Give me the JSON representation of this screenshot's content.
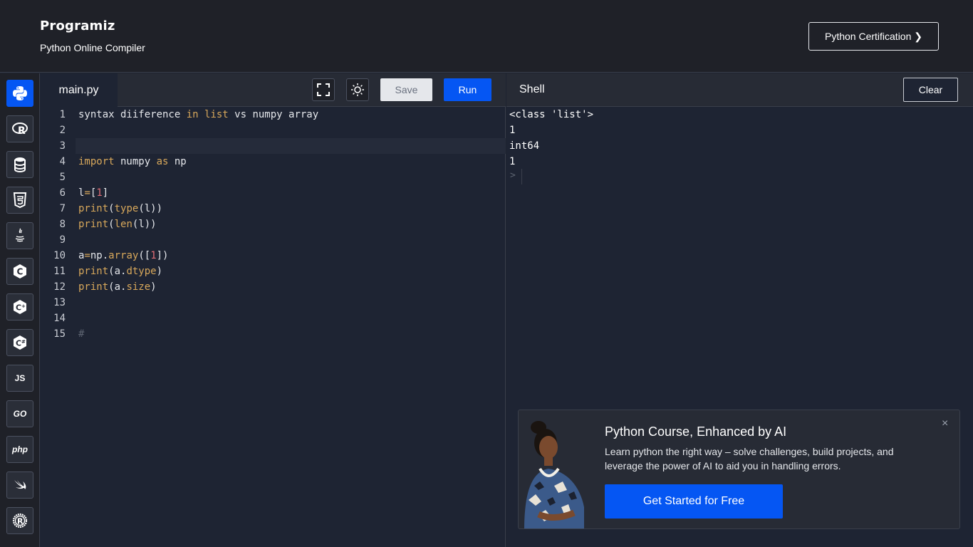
{
  "header": {
    "logo_text": "Programiz",
    "subtitle": "Python Online Compiler",
    "cert_button": "Python Certification ❯"
  },
  "sidebar": {
    "languages": [
      {
        "name": "python",
        "icon": "python-icon",
        "active": true
      },
      {
        "name": "r",
        "icon": "r-icon",
        "active": false
      },
      {
        "name": "sql",
        "icon": "database-icon",
        "active": false
      },
      {
        "name": "html",
        "icon": "html5-icon",
        "active": false
      },
      {
        "name": "java",
        "icon": "java-icon",
        "active": false
      },
      {
        "name": "c",
        "icon": "c-icon",
        "active": false
      },
      {
        "name": "cpp",
        "icon": "cpp-icon",
        "active": false
      },
      {
        "name": "csharp",
        "icon": "csharp-icon",
        "active": false
      },
      {
        "name": "js",
        "icon": "js-icon",
        "label": "JS",
        "active": false
      },
      {
        "name": "go",
        "icon": "go-icon",
        "label": "GO",
        "active": false
      },
      {
        "name": "php",
        "icon": "php-icon",
        "label": "php",
        "active": false
      },
      {
        "name": "swift",
        "icon": "swift-icon",
        "active": false
      },
      {
        "name": "rust",
        "icon": "rust-icon",
        "active": false
      }
    ]
  },
  "editor": {
    "tab_label": "main.py",
    "save_label": "Save",
    "run_label": "Run",
    "current_line": 3,
    "lines": [
      "syntax diiference in list vs numpy array",
      "",
      "",
      "import numpy as np",
      "",
      "l=[1]",
      "print(type(l))",
      "print(len(l))",
      "",
      "a=np.array([1])",
      "print(a.dtype)",
      "print(a.size)",
      "",
      "",
      "#"
    ]
  },
  "shell": {
    "title": "Shell",
    "clear_label": "Clear",
    "output": [
      "<class 'list'>",
      "1",
      "int64",
      "1"
    ],
    "prompt": ">"
  },
  "promo": {
    "title": "Python Course, Enhanced by AI",
    "description": "Learn python the right way – solve challenges, build projects, and leverage the power of AI to aid you in handling errors.",
    "cta": "Get Started for Free",
    "close": "×"
  },
  "colors": {
    "accent": "#0556f3",
    "bg": "#1e2433",
    "keyword": "#d8a85b",
    "number": "#e06c75"
  }
}
